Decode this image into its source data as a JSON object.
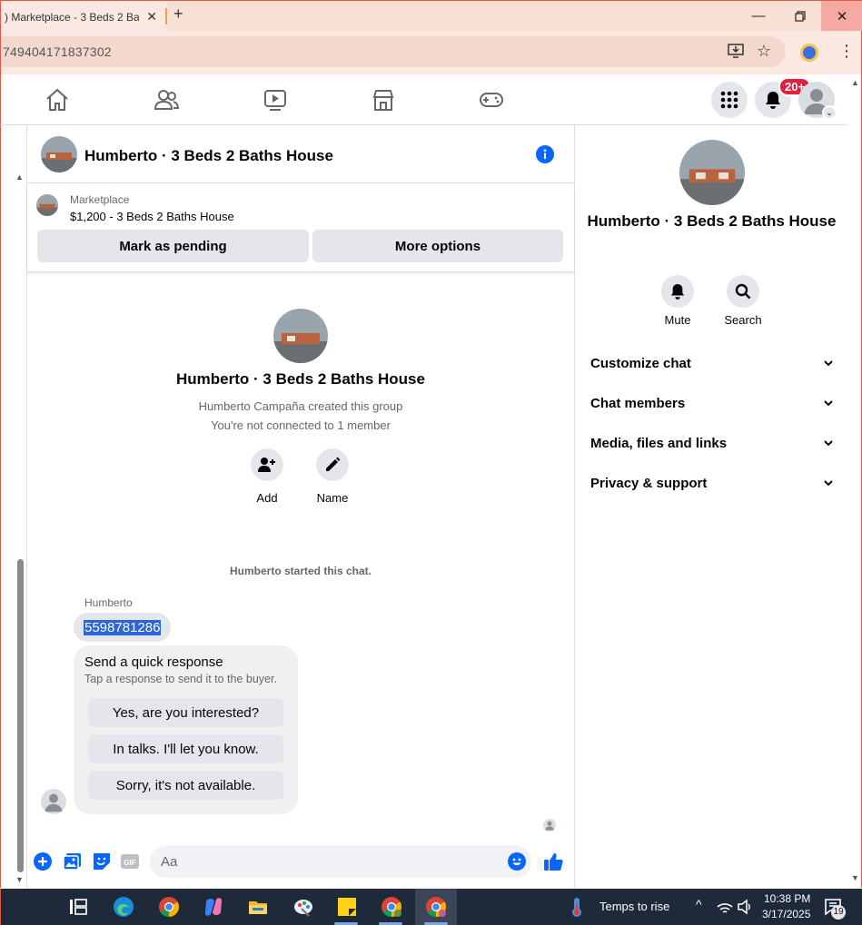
{
  "browser": {
    "tab_title": ") Marketplace - 3 Beds 2 Ba",
    "url": "749404171837302",
    "colors": {
      "accent": "#e05a4a"
    }
  },
  "nav": {
    "notification_badge": "20+"
  },
  "chat": {
    "header_title": "Humberto · 3 Beds 2 Baths House",
    "listing": {
      "label": "Marketplace",
      "price_line": "$1,200 - 3 Beds 2 Baths House",
      "pending_button": "Mark as pending",
      "more_button": "More options"
    },
    "group": {
      "title": "Humberto · 3 Beds 2 Baths House",
      "created_by": "Humberto Campaña created this group",
      "connection": "You're not connected to 1 member",
      "add_label": "Add",
      "name_label": "Name"
    },
    "started_notice": "Humberto started this chat.",
    "sender_name": "Humberto",
    "message_text": "5598781286",
    "quick_response": {
      "title": "Send a quick response",
      "subtitle": "Tap a response to send it to the buyer.",
      "options": [
        "Yes, are you interested?",
        "In talks. I'll let you know.",
        "Sorry, it's not available."
      ]
    },
    "composer_placeholder": "Aa"
  },
  "panel": {
    "title": "Humberto · 3 Beds 2 Baths House",
    "mute_label": "Mute",
    "search_label": "Search",
    "sections": [
      "Customize chat",
      "Chat members",
      "Media, files and links",
      "Privacy & support"
    ]
  },
  "taskbar": {
    "weather": "Temps to rise",
    "time": "10:38 PM",
    "date": "3/17/2025",
    "notifications": "19"
  }
}
